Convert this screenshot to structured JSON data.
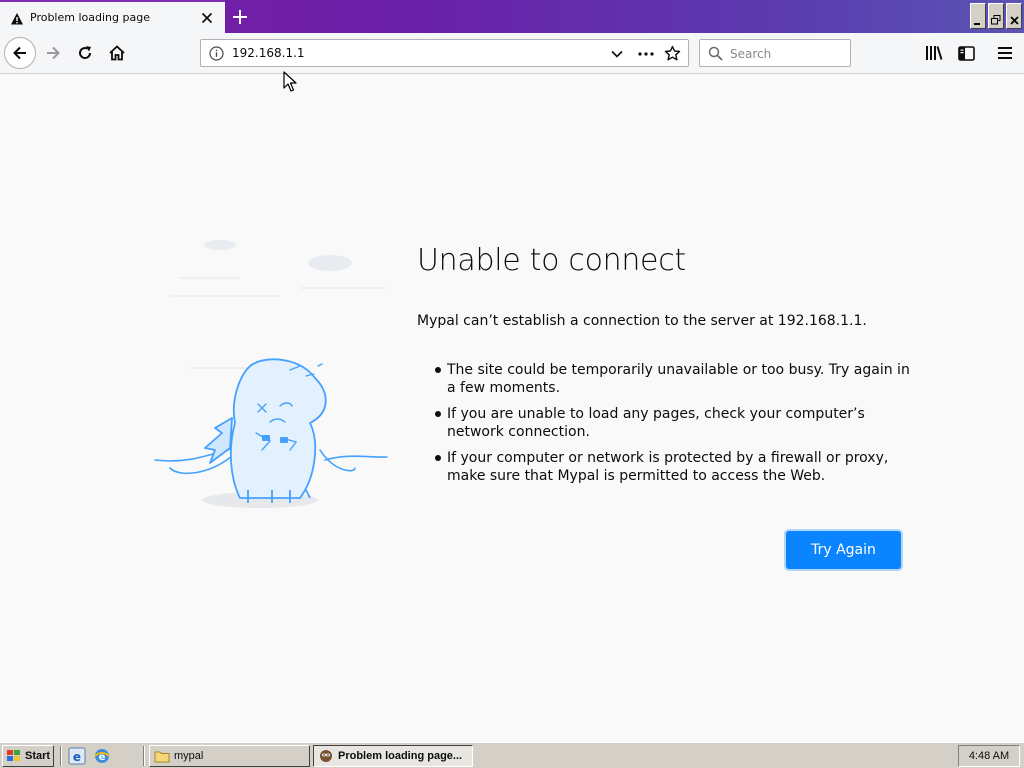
{
  "browser": {
    "tab": {
      "title": "Problem loading page"
    },
    "address": {
      "url": "192.168.1.1"
    },
    "search": {
      "placeholder": "Search"
    }
  },
  "page": {
    "heading": "Unable to connect",
    "description": "Mypal can’t establish a connection to the server at 192.168.1.1.",
    "reasons": [
      "The site could be temporarily unavailable or too busy. Try again in a few moments.",
      "If you are unable to load any pages, check your computer’s network connection.",
      "If your computer or network is protected by a firewall or proxy, make sure that Mypal is permitted to access the Web."
    ],
    "try_again_label": "Try Again"
  },
  "taskbar": {
    "start_label": "Start",
    "tasks": [
      {
        "label": "mypal"
      },
      {
        "label": "Problem loading page..."
      }
    ],
    "clock": "4:48 AM"
  },
  "colors": {
    "accent": "#0a84ff",
    "tabstrip": "#7a1fa2",
    "illustration": "#45a1ff"
  }
}
